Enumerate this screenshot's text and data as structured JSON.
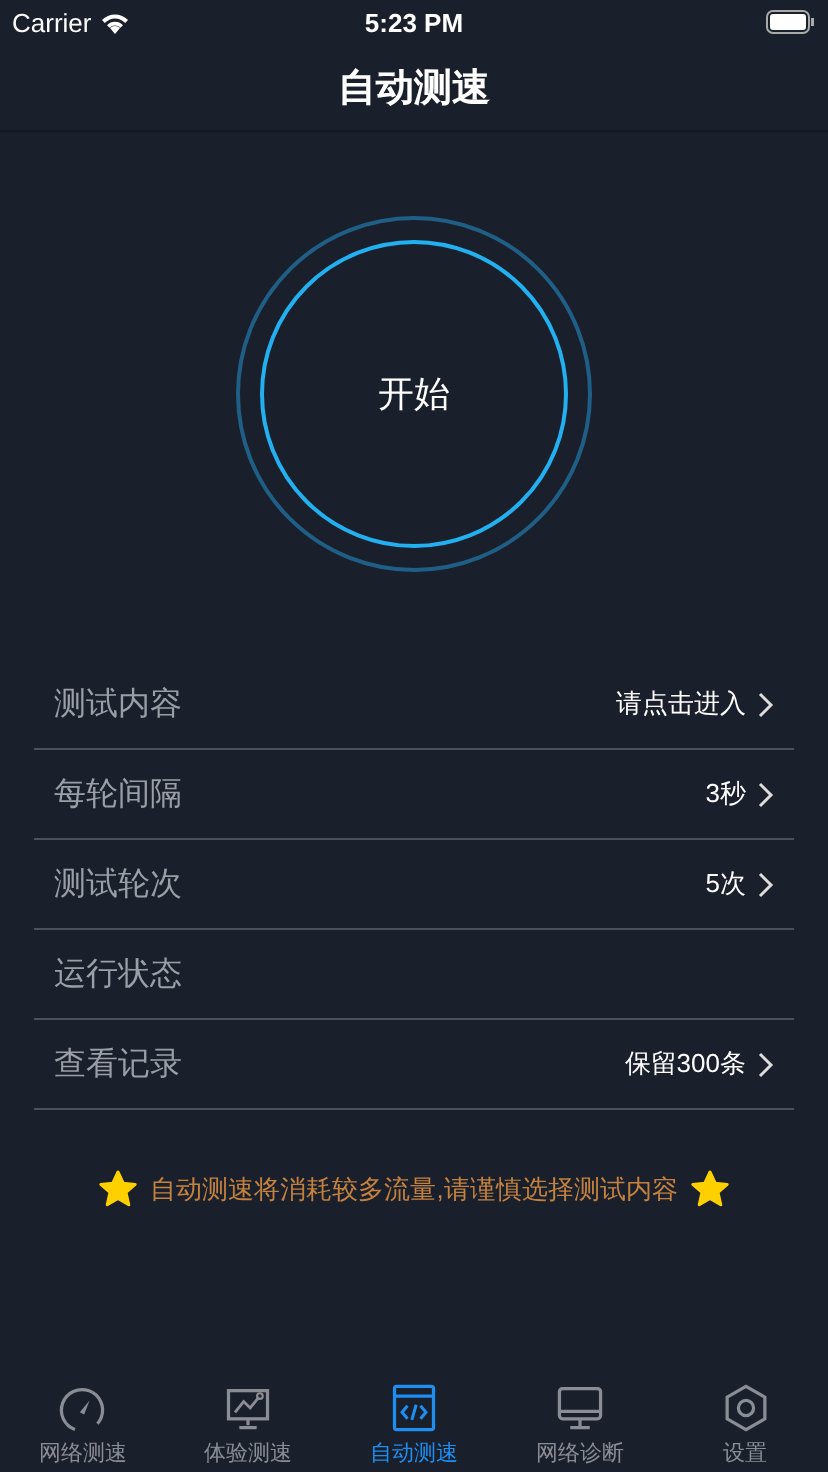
{
  "status_bar": {
    "carrier": "Carrier",
    "time": "5:23 PM"
  },
  "nav": {
    "title": "自动测速"
  },
  "start_button": {
    "label": "开始"
  },
  "settings": [
    {
      "kind": "link",
      "label": "测试内容",
      "value": "请点击进入"
    },
    {
      "kind": "link",
      "label": "每轮间隔",
      "value": "3秒"
    },
    {
      "kind": "link",
      "label": "测试轮次",
      "value": "5次"
    },
    {
      "kind": "status",
      "label": "运行状态"
    },
    {
      "kind": "link",
      "label": "查看记录",
      "value": "保留300条"
    }
  ],
  "notice": "自动测速将消耗较多流量,请谨慎选择测试内容",
  "tabs": [
    {
      "label": "网络测速",
      "selected": false
    },
    {
      "label": "体验测速",
      "selected": false
    },
    {
      "label": "自动测速",
      "selected": true
    },
    {
      "label": "网络诊断",
      "selected": false
    },
    {
      "label": "设置",
      "selected": false
    }
  ]
}
